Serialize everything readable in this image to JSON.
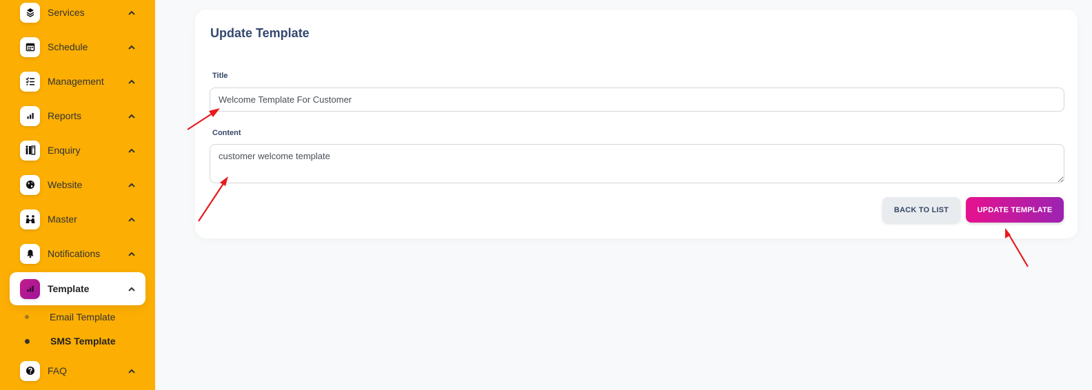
{
  "sidebar": {
    "items": [
      {
        "label": "Services",
        "icon": "services-icon"
      },
      {
        "label": "Schedule",
        "icon": "calendar-icon"
      },
      {
        "label": "Management",
        "icon": "checklist-icon"
      },
      {
        "label": "Reports",
        "icon": "bar-chart-icon"
      },
      {
        "label": "Enquiry",
        "icon": "enquiry-icon"
      },
      {
        "label": "Website",
        "icon": "globe-icon"
      },
      {
        "label": "Master",
        "icon": "people-icon"
      },
      {
        "label": "Notifications",
        "icon": "bell-icon"
      },
      {
        "label": "Template",
        "icon": "bar-chart-icon",
        "active": true
      },
      {
        "label": "FAQ",
        "icon": "question-icon"
      }
    ],
    "template_subitems": [
      {
        "label": "Email Template"
      },
      {
        "label": "SMS Template",
        "active": true
      }
    ]
  },
  "form": {
    "title": "Update Template",
    "title_label": "Title",
    "title_value": "Welcome Template For Customer",
    "content_label": "Content",
    "content_value": "customer welcome template",
    "back_button": "BACK TO LIST",
    "submit_button": "UPDATE TEMPLATE"
  },
  "colors": {
    "sidebar": "#fcae02",
    "accent_start": "#e6128e",
    "accent_end": "#9c23b2",
    "annotation_arrow": "#e8191b"
  }
}
